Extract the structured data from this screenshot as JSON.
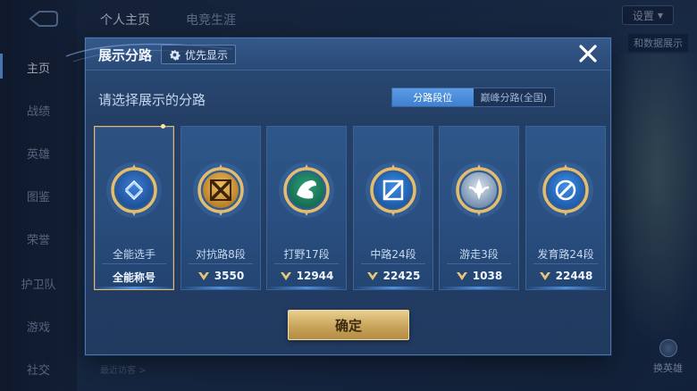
{
  "background": {
    "nav": [
      "主页",
      "战绩",
      "英雄",
      "图鉴",
      "荣誉",
      "护卫队",
      "游戏",
      "社交"
    ],
    "top_tabs": [
      "个人主页",
      "电竞生涯"
    ],
    "settings_label": "设置",
    "hint_text": "和数据展示",
    "recent_visit_label": "最近访客 >",
    "swap_hero_label": "换英雄"
  },
  "modal": {
    "title": "展示分路",
    "priority_label": "优先显示",
    "subtitle": "请选择展示的分路",
    "segments": [
      "分路段位",
      "巅峰分路(全国)"
    ],
    "active_segment": 0,
    "confirm_label": "确定",
    "cards": [
      {
        "label": "全能选手",
        "stat": "全能称号",
        "has_icon": false,
        "emblem": "allround",
        "selected": true
      },
      {
        "label": "对抗路8段",
        "stat": "3550",
        "has_icon": true,
        "emblem": "clash",
        "selected": false
      },
      {
        "label": "打野17段",
        "stat": "12944",
        "has_icon": true,
        "emblem": "jungle",
        "selected": false
      },
      {
        "label": "中路24段",
        "stat": "22425",
        "has_icon": true,
        "emblem": "mid",
        "selected": false
      },
      {
        "label": "游走3段",
        "stat": "1038",
        "has_icon": true,
        "emblem": "roam",
        "selected": false
      },
      {
        "label": "发育路24段",
        "stat": "22448",
        "has_icon": true,
        "emblem": "farm",
        "selected": false
      }
    ]
  },
  "colors": {
    "accent_gold": "#e0b86e",
    "segment_active": "#4f8fe0",
    "panel": "#243f66"
  }
}
